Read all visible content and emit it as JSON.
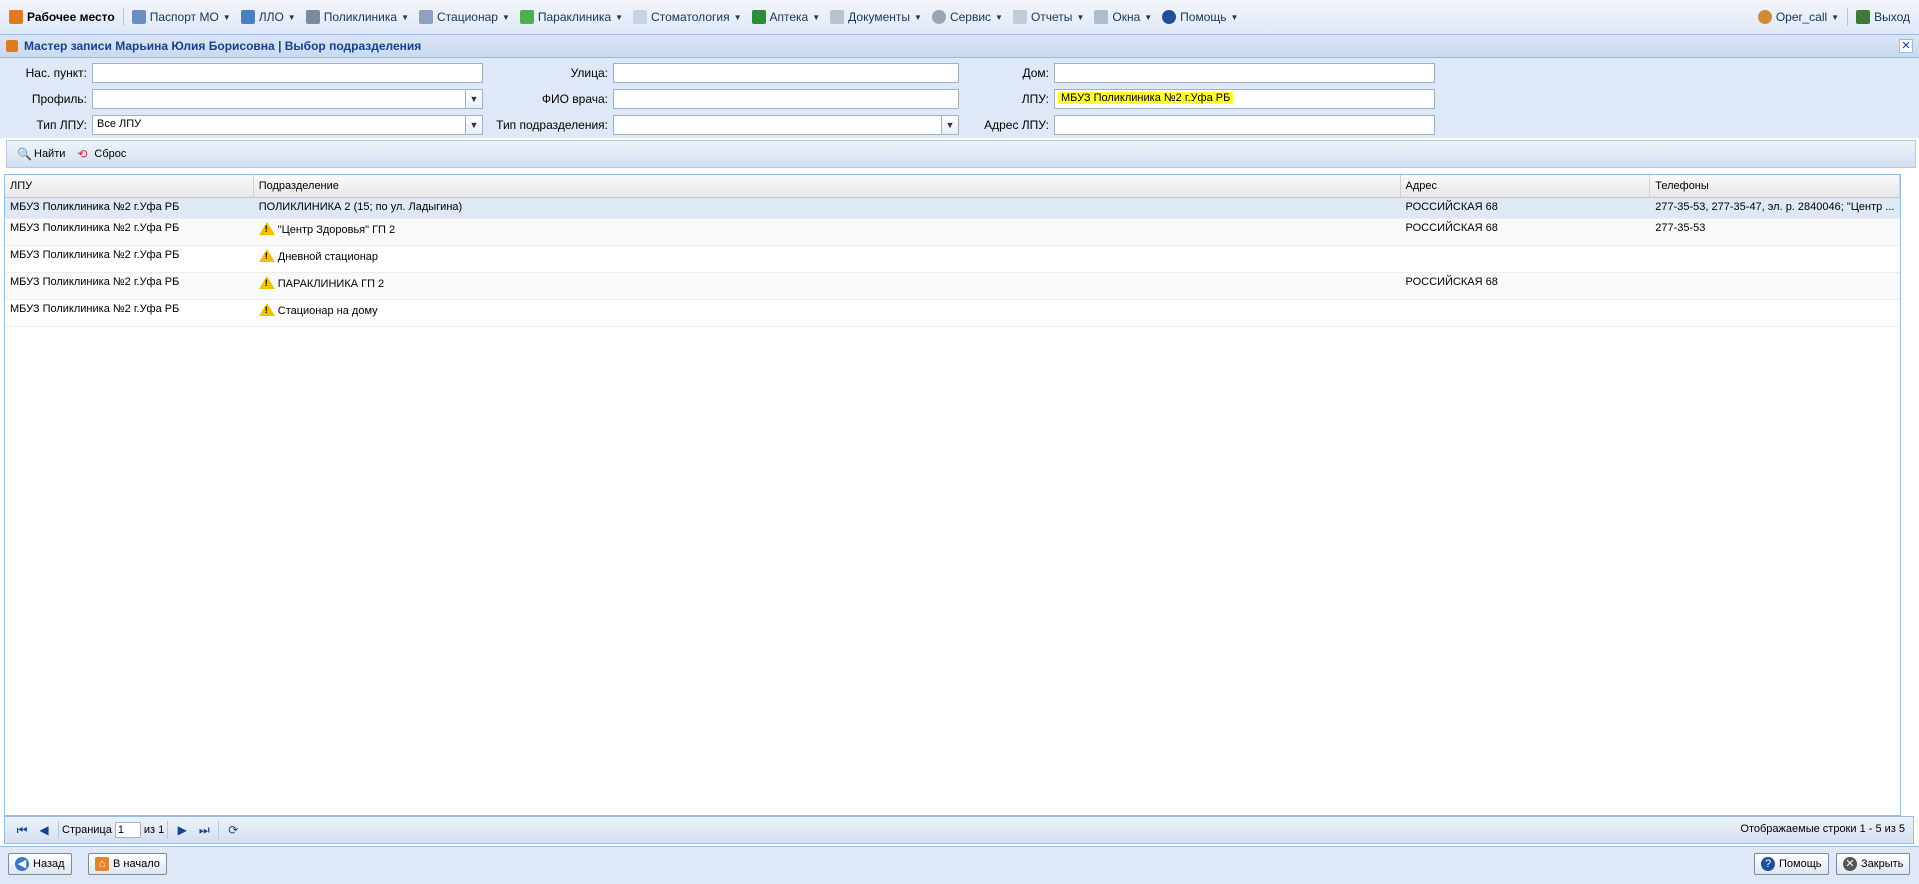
{
  "menubar": {
    "items": [
      {
        "label": "Рабочее место",
        "icon": "workplace-icon",
        "arrow": false
      },
      {
        "label": "Паспорт МО",
        "icon": "passport-icon",
        "arrow": true
      },
      {
        "label": "ЛЛО",
        "icon": "llo-icon",
        "arrow": true
      },
      {
        "label": "Поликлиника",
        "icon": "stethoscope-icon",
        "arrow": true
      },
      {
        "label": "Стационар",
        "icon": "hospital-bed-icon",
        "arrow": true
      },
      {
        "label": "Параклиника",
        "icon": "flask-icon",
        "arrow": true
      },
      {
        "label": "Стоматология",
        "icon": "tooth-icon",
        "arrow": true
      },
      {
        "label": "Аптека",
        "icon": "pharmacy-icon",
        "arrow": true
      },
      {
        "label": "Документы",
        "icon": "document-icon",
        "arrow": true
      },
      {
        "label": "Сервис",
        "icon": "gear-icon",
        "arrow": true
      },
      {
        "label": "Отчеты",
        "icon": "report-icon",
        "arrow": true
      },
      {
        "label": "Окна",
        "icon": "windows-icon",
        "arrow": true
      },
      {
        "label": "Помощь",
        "icon": "help-icon",
        "arrow": true
      }
    ],
    "user": "Oper_call",
    "exit": "Выход"
  },
  "window": {
    "title": "Мастер записи Марьина Юлия Борисовна | Выбор подразделения"
  },
  "filters": {
    "settlement_label": "Нас. пункт:",
    "settlement_value": "",
    "street_label": "Улица:",
    "street_value": "",
    "house_label": "Дом:",
    "house_value": "",
    "profile_label": "Профиль:",
    "profile_value": "",
    "doctor_label": "ФИО врача:",
    "doctor_value": "",
    "lpu_label": "ЛПУ:",
    "lpu_value": "МБУЗ Поликлиника №2 г.Уфа РБ",
    "lpu_type_label": "Тип ЛПУ:",
    "lpu_type_value": "Все ЛПУ",
    "dept_type_label": "Тип подразделения:",
    "dept_type_value": "",
    "lpu_address_label": "Адрес ЛПУ:",
    "lpu_address_value": ""
  },
  "toolbar": {
    "find_label": "Найти",
    "reset_label": "Сброс"
  },
  "grid": {
    "columns": [
      "ЛПУ",
      "Подразделение",
      "Адрес",
      "Телефоны"
    ],
    "rows": [
      {
        "lpu": "МБУЗ Поликлиника №2 г.Уфа РБ",
        "dept": "ПОЛИКЛИНИКА 2 (15; по ул. Ладыгина)",
        "address": "РОССИЙСКАЯ 68",
        "phones": "277-35-53, 277-35-47, эл. р. 2840046; \"Центр ...",
        "warn": false
      },
      {
        "lpu": "МБУЗ Поликлиника №2 г.Уфа РБ",
        "dept": "\"Центр Здоровья\" ГП 2",
        "address": "РОССИЙСКАЯ 68",
        "phones": "277-35-53",
        "warn": true
      },
      {
        "lpu": "МБУЗ Поликлиника №2 г.Уфа РБ",
        "dept": "Дневной стационар",
        "address": "",
        "phones": "",
        "warn": true
      },
      {
        "lpu": "МБУЗ Поликлиника №2 г.Уфа РБ",
        "dept": "ПАРАКЛИНИКА ГП 2",
        "address": "РОССИЙСКАЯ 68",
        "phones": "",
        "warn": true
      },
      {
        "lpu": "МБУЗ Поликлиника №2 г.Уфа РБ",
        "dept": "Стационар на дому",
        "address": "",
        "phones": "",
        "warn": true
      }
    ]
  },
  "pager": {
    "page_label": "Страница",
    "page_value": "1",
    "of_label": "из 1",
    "info": "Отображаемые строки 1 - 5 из 5"
  },
  "footer": {
    "back_label": "Назад",
    "home_label": "В начало",
    "help_label": "Помощь",
    "close_label": "Закрыть"
  },
  "colors": {
    "accent": "#15428b",
    "highlight": "#ffff33",
    "panel": "#dfe8f6"
  }
}
